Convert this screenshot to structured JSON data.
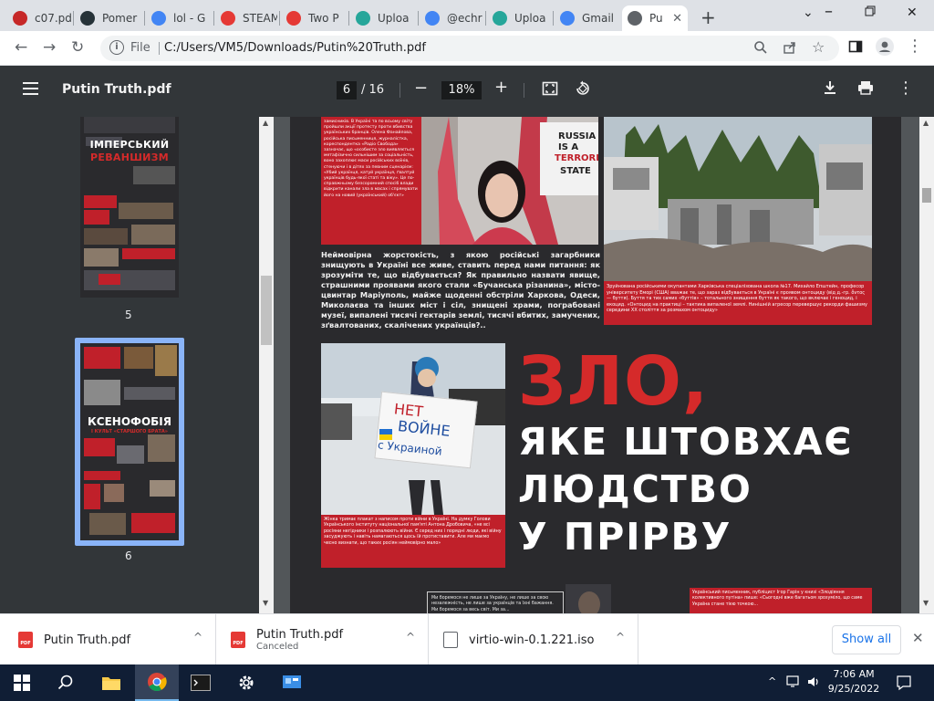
{
  "browser": {
    "tabs": [
      {
        "label": "c07.pd",
        "color": "#c62828"
      },
      {
        "label": "Pomer",
        "color": "#263238"
      },
      {
        "label": "lol - G",
        "color": "#4285f4"
      },
      {
        "label": "STEAM",
        "color": "#e53935"
      },
      {
        "label": "Two P",
        "color": "#e53935"
      },
      {
        "label": "Uploa",
        "color": "#26a69a"
      },
      {
        "label": "@echr",
        "color": "#4285f4"
      },
      {
        "label": "Uploa",
        "color": "#26a69a"
      },
      {
        "label": "Gmail",
        "color": "#4285f4"
      },
      {
        "label": "Pu",
        "color": "#5f6368",
        "active": true
      }
    ],
    "url_scheme": "File",
    "url": "C:/Users/VM5/Downloads/Putin%20Truth.pdf"
  },
  "pdf": {
    "title": "Putin Truth.pdf",
    "page_current": "6",
    "page_total": "/ 16",
    "zoom": "18%",
    "thumbnails": [
      {
        "label": "5",
        "headline_top": "ІМПЕРСЬКИЙ",
        "headline_bottom": "РЕВАНШИЗМ"
      },
      {
        "label": "6",
        "headline_top": "КСЕНОФОБІЯ",
        "headline_bottom": "І КУЛЬТ «СТАРШОГО БРАТА»"
      }
    ]
  },
  "page_content": {
    "red_caption_1": "замисників. В Україні та по всьому світу пройшли акції протесту проти вбивства українських бранців. Олена Фанайлова, російська письменниця, журналістка, кореспондентка «Радіо Свобода» зазначає, що «особисте зло виявляється метафізично сильнішим за соціальність, воно захоплює маси російських воїнів, стенуючи і в дітях за певним сценарієм: «Убий українця, катуй українця, ґвалтуй українців будь-якої статі та віку». Це по-справжньому безсоромний спосіб влади відкрити канали зла в масах і спрямувати його на новий (український) об'єкт»",
    "sign_text_1": "RUSSIA",
    "sign_text_2": "IS A",
    "sign_text_3": "TERRORIST",
    "sign_text_4": "STATE",
    "body_paragraph": "Неймовірна жорстокість, з якою російські загарбники знищують в Україні все живе, ставить перед нами питання: як зрозуміти те, що відбувається? Як правильно назвати явище, страшними проявами якого стали «Бучанська різанина», місто-цвинтар Маріуполь, майже щоденні обстріли Харкова, Одеси, Миколаєва та інших міст і сіл, знищені храми, пограбовані музеї, випалені тисячі гектарів землі, тисячі вбитих, замучених, зґвалтованих, скалічених українців?..",
    "red_caption_2": "Зруйнована російськими окупантами Харківська спеціалізована школа №17. Михайло Епштейн, професор університету Еморі (США) вважає те, що зараз відбувається в Україні є проявом онтоциду (від д.-гр. ὄντος — буття). Буття та тих самих «буттів» – тотального знищення буття як такого, що включає і геноцид, і екоцид. «Онтоцид на практиці – тактика випаленої землі. Нинішній агресор перевершує рекорди фашизму середини ХХ століття за розмахом онтоциду»",
    "protest_sign_line1": "НЕТ",
    "protest_sign_line2": "ВОЙНЕ",
    "protest_sign_line3": "с Украиной",
    "red_caption_3": "Жінка тримає плакат з написом проти війни в Україні. На думку Голови Українського інституту національної пам'яті Антона Дробовича, «не всі росіяни негідники і розпалюють війни. Є серед них і порядні люди, які війну засуджують і навіть намагаються щось їй протиставити. Але ми маємо чесно визнати, що таких росіян неймовірно мало»",
    "headline_1": "ЗЛО,",
    "headline_2": "ЯКЕ ШТОВХАЄ",
    "headline_3": "ЛЮДСТВО",
    "headline_4": "У ПРІРВУ",
    "quote_box": "Ми боремося не лише за Україну, не лише за свою незалежність, не лише за українців та їхні бажання. Ми боремося за весь світ. Ми за...",
    "red_caption_4": "Український письменник, публіцист Ігор Гарін у книзі «Злодіяння колективного путіна» пише: «Сьогодні вже багатьом зрозуміло, що саме Україна стане тією точкою..."
  },
  "downloads": {
    "items": [
      {
        "name": "Putin Truth.pdf",
        "status": "",
        "type": "pdf"
      },
      {
        "name": "Putin Truth.pdf",
        "status": "Canceled",
        "type": "pdf"
      },
      {
        "name": "virtio-win-0.1.221.iso",
        "status": "",
        "type": "iso"
      }
    ],
    "show_all": "Show all"
  },
  "taskbar": {
    "time": "7:06 AM",
    "date": "9/25/2022"
  },
  "colors": {
    "chrome_bg": "#dee1e6",
    "pdf_toolbar": "#323639",
    "viewer_bg": "#525659",
    "accent_red": "#c0202a",
    "headline_red": "#d52a2a",
    "taskbar": "#101e35",
    "thumb_selected": "#8ab4f8"
  }
}
